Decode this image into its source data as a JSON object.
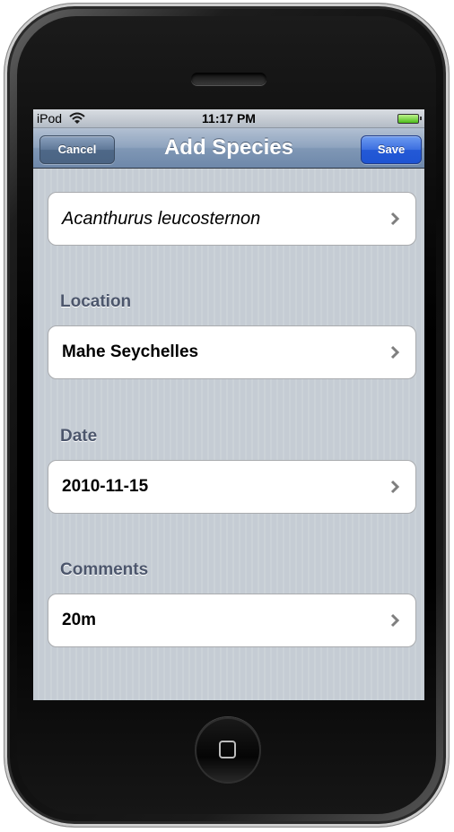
{
  "status_bar": {
    "carrier": "iPod",
    "time": "11:17 PM",
    "icons": [
      "wifi-icon",
      "battery-icon"
    ]
  },
  "nav_bar": {
    "title": "Add Species",
    "cancel_label": "Cancel",
    "save_label": "Save"
  },
  "species": {
    "value": "Acanthurus leucosternon"
  },
  "location": {
    "header": "Location",
    "value": "Mahe Seychelles"
  },
  "date": {
    "header": "Date",
    "value": "2010-11-15"
  },
  "comments": {
    "header": "Comments",
    "value": "20m"
  },
  "colors": {
    "nav_bar": "#7f97b5",
    "save_button": "#2459d6",
    "background": "#c5ccd4",
    "section_header": "#4c566c"
  }
}
